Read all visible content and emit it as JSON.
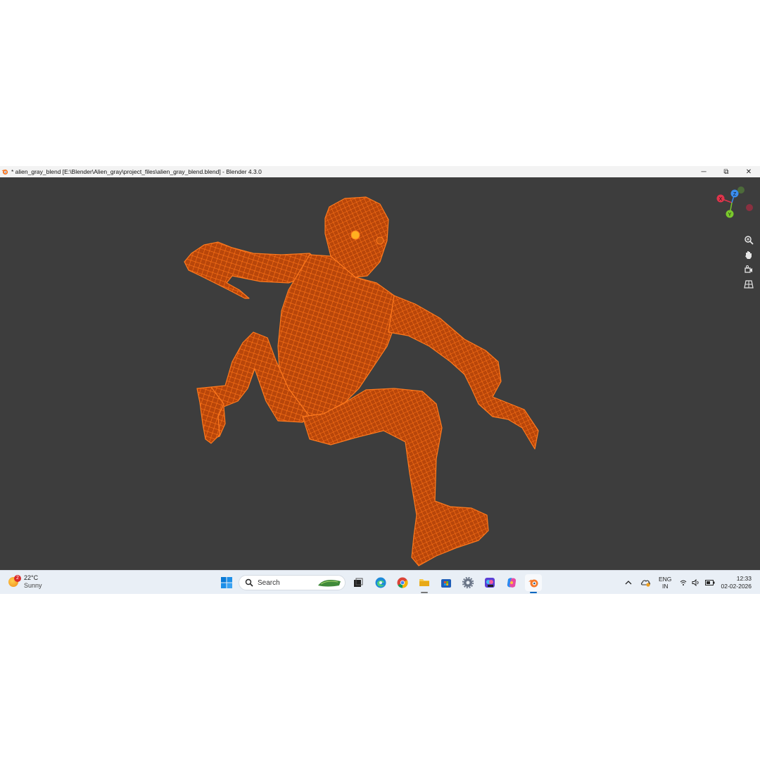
{
  "window": {
    "title": "* alien_gray_blend [E:\\Blender\\Alien_gray\\project_files\\alien_gray_blend.blend] - Blender 4.3.0",
    "app_icon": "blender-icon",
    "controls": {
      "minimize": "─",
      "restore": "⧉",
      "close": "✕"
    }
  },
  "viewport": {
    "background": "#3d3d3d",
    "mesh_color": "#ff6a0d",
    "gizmo": {
      "x_label": "X",
      "y_label": "Y",
      "z_label": "Z",
      "x_color": "#e0344b",
      "y_color": "#7ac92c",
      "z_color": "#3a8df0"
    },
    "tools": [
      "zoom-icon",
      "hand-pan-icon",
      "camera-icon",
      "grid-ortho-icon"
    ]
  },
  "taskbar": {
    "weather": {
      "temp": "22°C",
      "condition": "Sunny",
      "badge": "2"
    },
    "search": {
      "placeholder": "Search"
    },
    "apps": [
      "start-icon",
      "task-view-icon",
      "edge-icon",
      "chrome-icon",
      "file-explorer-icon",
      "microsoft-store-icon",
      "settings-icon",
      "app-icon",
      "copilot-icon",
      "blender-icon"
    ],
    "tray": {
      "lang_top": "ENG",
      "lang_bottom": "IN",
      "time": "12:33",
      "date": "02-02-2026"
    }
  }
}
